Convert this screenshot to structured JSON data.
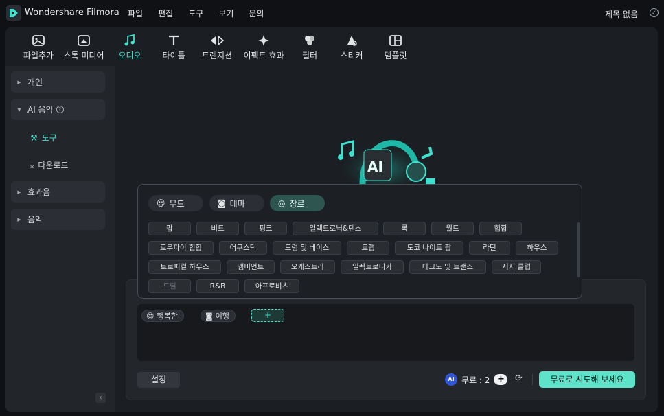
{
  "app": {
    "title": "Wondershare Filmora",
    "project": "제목 없음"
  },
  "menu": [
    "파일",
    "편집",
    "도구",
    "보기",
    "문의"
  ],
  "toolbar": [
    {
      "label": "파일추가",
      "icon": "import-icon"
    },
    {
      "label": "스톡 미디어",
      "icon": "cloud-icon"
    },
    {
      "label": "오디오",
      "icon": "music-note-icon"
    },
    {
      "label": "타이틀",
      "icon": "text-t-icon"
    },
    {
      "label": "트랜지션",
      "icon": "transition-arrows-icon"
    },
    {
      "label": "이펙트 효과",
      "icon": "sparkle-icon"
    },
    {
      "label": "필터",
      "icon": "filter-circles-icon"
    },
    {
      "label": "스티커",
      "icon": "sticker-icon"
    },
    {
      "label": "템플릿",
      "icon": "template-icon"
    }
  ],
  "sidebar": {
    "items": [
      "개인",
      "AI 음악",
      "효과음",
      "음악"
    ],
    "sub_items": [
      "도구",
      "다운로드"
    ]
  },
  "popup": {
    "tabs": [
      "무드",
      "테마",
      "장르"
    ],
    "genres": [
      [
        "팝",
        "비트",
        "펑크",
        "일렉트로닉&댄스",
        "록",
        "월드",
        "힙합"
      ],
      [
        "로우파이 힙합",
        "어쿠스틱",
        "드럼 및 베이스",
        "트랩",
        "도코 나이트 팝",
        "라틴",
        "하우스"
      ],
      [
        "트로피컬 하우스",
        "앰비언트",
        "오케스트라",
        "일렉트로니카",
        "테크노 및 트랜스",
        "저지 클럽"
      ],
      [
        "드릴",
        "R&B",
        "아프로비츠"
      ]
    ]
  },
  "prompt": {
    "chips": [
      "행복한",
      "여행"
    ],
    "add": "+"
  },
  "footer": {
    "settings": "설정",
    "free": "무료 : 2",
    "try": "무료로 시도해 보세요"
  },
  "colors": {
    "accent": "#3fe0cd",
    "button": "#5ce3c9"
  }
}
